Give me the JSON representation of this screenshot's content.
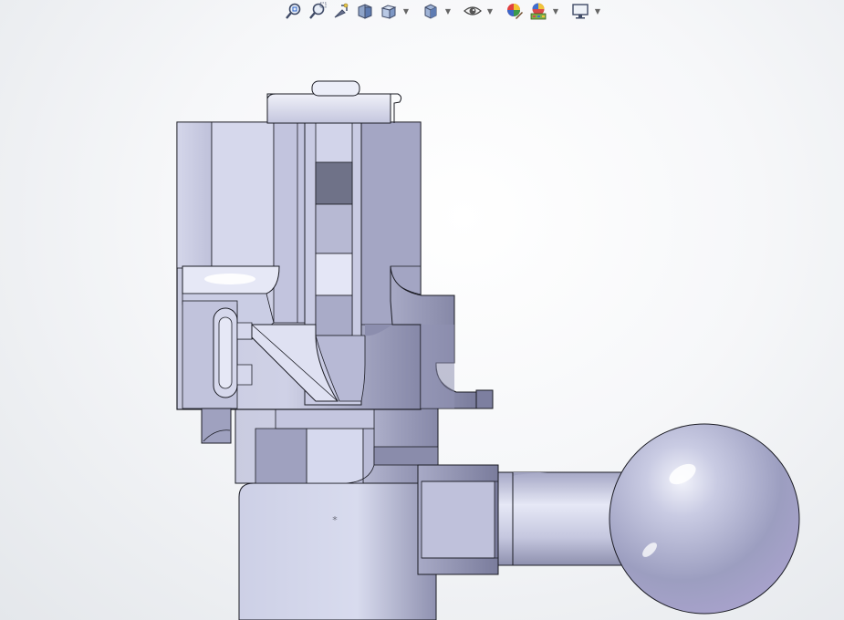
{
  "app": "3D CAD viewport",
  "toolbar": {
    "items": [
      {
        "name": "zoom-to-fit-icon"
      },
      {
        "name": "zoom-to-area-icon"
      },
      {
        "name": "previous-view-icon"
      },
      {
        "name": "section-view-icon"
      },
      {
        "name": "view-orientation-icon",
        "has_dropdown": true
      },
      {
        "name": "display-style-icon",
        "has_dropdown": true
      },
      {
        "name": "hide-show-items-icon",
        "has_dropdown": true
      },
      {
        "name": "edit-appearance-icon"
      },
      {
        "name": "apply-scene-icon",
        "has_dropdown": true
      },
      {
        "name": "view-settings-icon",
        "has_dropdown": true
      }
    ]
  },
  "viewport": {
    "origin_marker": "*"
  },
  "colors": {
    "part_light": "#d6d8ec",
    "part_mid": "#a9abc8",
    "part_dark": "#6e7090",
    "edge": "#1b1c24",
    "background": "#f3f4f6"
  }
}
